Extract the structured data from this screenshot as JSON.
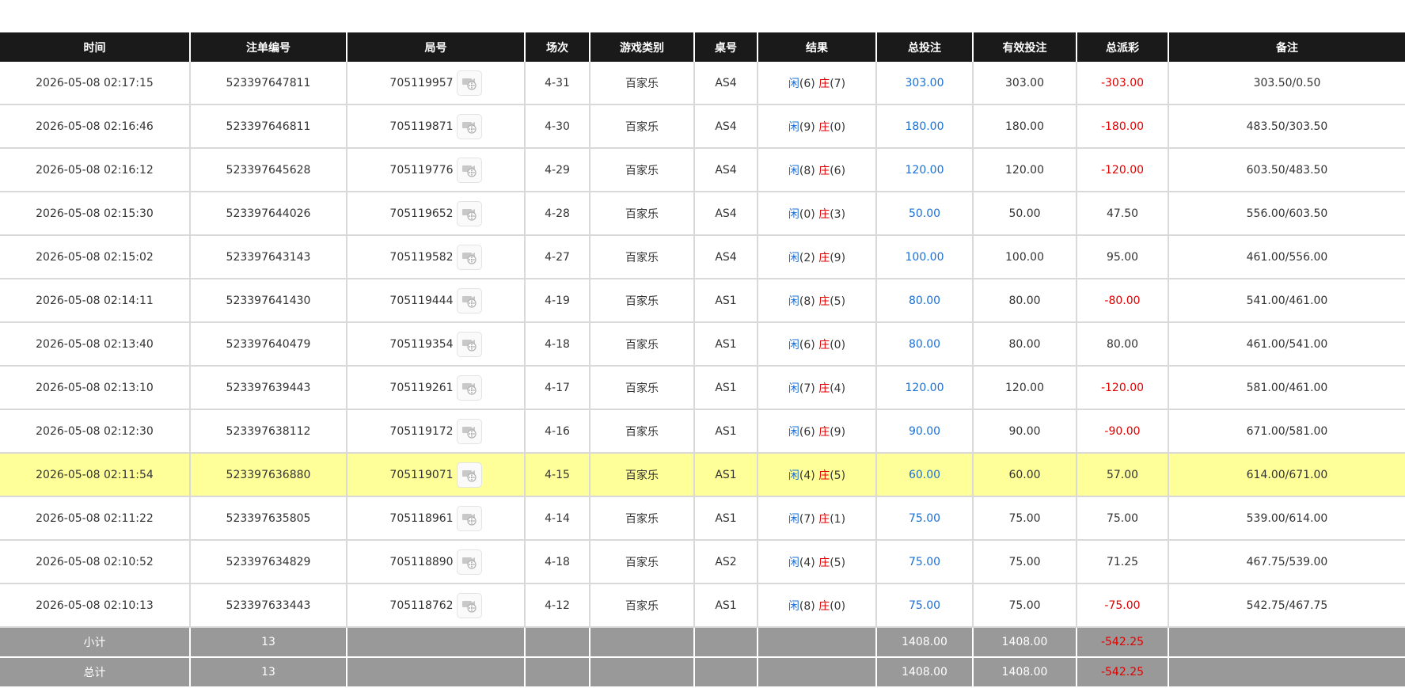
{
  "headers": [
    "时间",
    "注单编号",
    "局号",
    "场次",
    "游戏类别",
    "桌号",
    "结果",
    "总投注",
    "有效投注",
    "总派彩",
    "备注"
  ],
  "rows": [
    {
      "time": "2026-05-08 02:17:15",
      "bet_id": "523397647811",
      "round": "705119957",
      "session": "4-31",
      "game": "百家乐",
      "table": "AS4",
      "player_label": "闲",
      "player": "(6)",
      "banker_label": "庄",
      "banker": "(7)",
      "total_bet": "303.00",
      "valid_bet": "303.00",
      "payout": "-303.00",
      "payout_negative": true,
      "note": "303.50/0.50",
      "highlight": false
    },
    {
      "time": "2026-05-08 02:16:46",
      "bet_id": "523397646811",
      "round": "705119871",
      "session": "4-30",
      "game": "百家乐",
      "table": "AS4",
      "player_label": "闲",
      "player": "(9)",
      "banker_label": "庄",
      "banker": "(0)",
      "total_bet": "180.00",
      "valid_bet": "180.00",
      "payout": "-180.00",
      "payout_negative": true,
      "note": "483.50/303.50",
      "highlight": false
    },
    {
      "time": "2026-05-08 02:16:12",
      "bet_id": "523397645628",
      "round": "705119776",
      "session": "4-29",
      "game": "百家乐",
      "table": "AS4",
      "player_label": "闲",
      "player": "(8)",
      "banker_label": "庄",
      "banker": "(6)",
      "total_bet": "120.00",
      "valid_bet": "120.00",
      "payout": "-120.00",
      "payout_negative": true,
      "note": "603.50/483.50",
      "highlight": false
    },
    {
      "time": "2026-05-08 02:15:30",
      "bet_id": "523397644026",
      "round": "705119652",
      "session": "4-28",
      "game": "百家乐",
      "table": "AS4",
      "player_label": "闲",
      "player": "(0)",
      "banker_label": "庄",
      "banker": "(3)",
      "total_bet": "50.00",
      "valid_bet": "50.00",
      "payout": "47.50",
      "payout_negative": false,
      "note": "556.00/603.50",
      "highlight": false
    },
    {
      "time": "2026-05-08 02:15:02",
      "bet_id": "523397643143",
      "round": "705119582",
      "session": "4-27",
      "game": "百家乐",
      "table": "AS4",
      "player_label": "闲",
      "player": "(2)",
      "banker_label": "庄",
      "banker": "(9)",
      "total_bet": "100.00",
      "valid_bet": "100.00",
      "payout": "95.00",
      "payout_negative": false,
      "note": "461.00/556.00",
      "highlight": false
    },
    {
      "time": "2026-05-08 02:14:11",
      "bet_id": "523397641430",
      "round": "705119444",
      "session": "4-19",
      "game": "百家乐",
      "table": "AS1",
      "player_label": "闲",
      "player": "(8)",
      "banker_label": "庄",
      "banker": "(5)",
      "total_bet": "80.00",
      "valid_bet": "80.00",
      "payout": "-80.00",
      "payout_negative": true,
      "note": "541.00/461.00",
      "highlight": false
    },
    {
      "time": "2026-05-08 02:13:40",
      "bet_id": "523397640479",
      "round": "705119354",
      "session": "4-18",
      "game": "百家乐",
      "table": "AS1",
      "player_label": "闲",
      "player": "(6)",
      "banker_label": "庄",
      "banker": "(0)",
      "total_bet": "80.00",
      "valid_bet": "80.00",
      "payout": "80.00",
      "payout_negative": false,
      "note": "461.00/541.00",
      "highlight": false
    },
    {
      "time": "2026-05-08 02:13:10",
      "bet_id": "523397639443",
      "round": "705119261",
      "session": "4-17",
      "game": "百家乐",
      "table": "AS1",
      "player_label": "闲",
      "player": "(7)",
      "banker_label": "庄",
      "banker": "(4)",
      "total_bet": "120.00",
      "valid_bet": "120.00",
      "payout": "-120.00",
      "payout_negative": true,
      "note": "581.00/461.00",
      "highlight": false
    },
    {
      "time": "2026-05-08 02:12:30",
      "bet_id": "523397638112",
      "round": "705119172",
      "session": "4-16",
      "game": "百家乐",
      "table": "AS1",
      "player_label": "闲",
      "player": "(6)",
      "banker_label": "庄",
      "banker": "(9)",
      "total_bet": "90.00",
      "valid_bet": "90.00",
      "payout": "-90.00",
      "payout_negative": true,
      "note": "671.00/581.00",
      "highlight": false
    },
    {
      "time": "2026-05-08 02:11:54",
      "bet_id": "523397636880",
      "round": "705119071",
      "session": "4-15",
      "game": "百家乐",
      "table": "AS1",
      "player_label": "闲",
      "player": "(4)",
      "banker_label": "庄",
      "banker": "(5)",
      "total_bet": "60.00",
      "valid_bet": "60.00",
      "payout": "57.00",
      "payout_negative": false,
      "note": "614.00/671.00",
      "highlight": true
    },
    {
      "time": "2026-05-08 02:11:22",
      "bet_id": "523397635805",
      "round": "705118961",
      "session": "4-14",
      "game": "百家乐",
      "table": "AS1",
      "player_label": "闲",
      "player": "(7)",
      "banker_label": "庄",
      "banker": "(1)",
      "total_bet": "75.00",
      "valid_bet": "75.00",
      "payout": "75.00",
      "payout_negative": false,
      "note": "539.00/614.00",
      "highlight": false
    },
    {
      "time": "2026-05-08 02:10:52",
      "bet_id": "523397634829",
      "round": "705118890",
      "session": "4-18",
      "game": "百家乐",
      "table": "AS2",
      "player_label": "闲",
      "player": "(4)",
      "banker_label": "庄",
      "banker": "(5)",
      "total_bet": "75.00",
      "valid_bet": "75.00",
      "payout": "71.25",
      "payout_negative": false,
      "note": "467.75/539.00",
      "highlight": false
    },
    {
      "time": "2026-05-08 02:10:13",
      "bet_id": "523397633443",
      "round": "705118762",
      "session": "4-12",
      "game": "百家乐",
      "table": "AS1",
      "player_label": "闲",
      "player": "(8)",
      "banker_label": "庄",
      "banker": "(0)",
      "total_bet": "75.00",
      "valid_bet": "75.00",
      "payout": "-75.00",
      "payout_negative": true,
      "note": "542.75/467.75",
      "highlight": false
    }
  ],
  "footer": [
    {
      "label": "小计",
      "count": "13",
      "total_bet": "1408.00",
      "valid_bet": "1408.00",
      "payout": "-542.25"
    },
    {
      "label": "总计",
      "count": "13",
      "total_bet": "1408.00",
      "valid_bet": "1408.00",
      "payout": "-542.25"
    }
  ],
  "colors": {
    "header_bg": "#1a1a1a",
    "footer_bg": "#999999",
    "highlight": "#ffff99",
    "blue": "#1a6fd6",
    "red": "#e00000"
  },
  "icons": {
    "round_replay": "video-replay-icon"
  }
}
